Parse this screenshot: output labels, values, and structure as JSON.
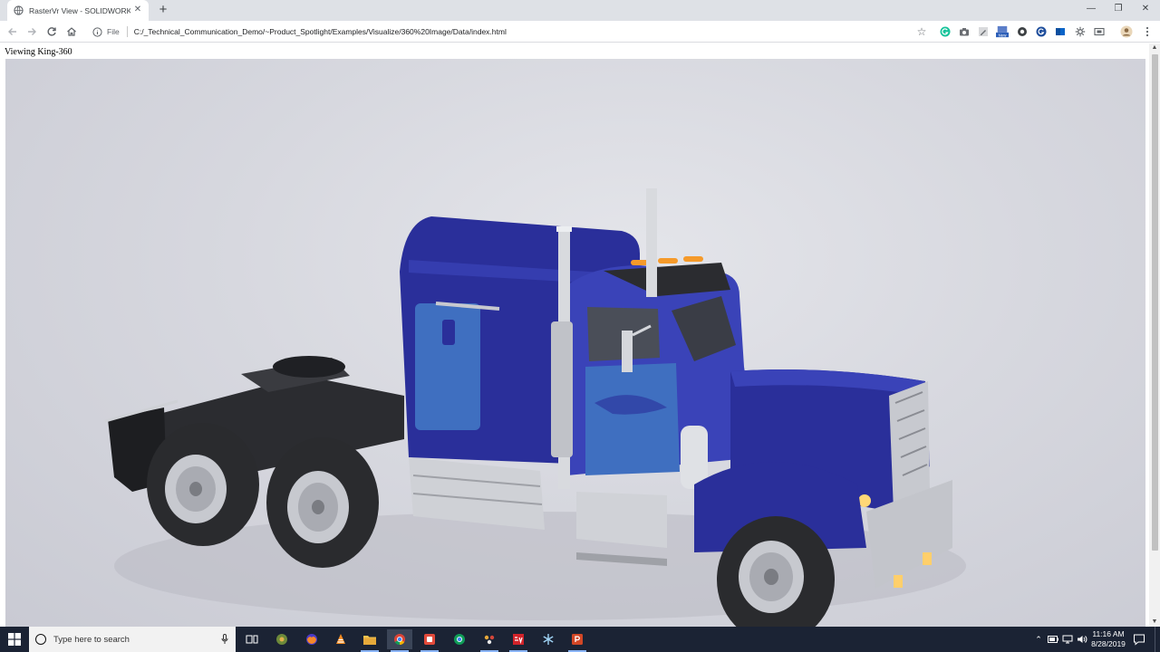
{
  "browser": {
    "tab_title": "RasterVr View - SOLIDWORKS Vis",
    "new_tab_symbol": "+",
    "close_symbol": "✕",
    "window_controls": [
      "—",
      "❐",
      "✕"
    ],
    "address_scheme": "File",
    "address_url": "C:/_Technical_Communication_Demo/~Product_Spotlight/Examples/Visualize/360%20Image/Data/index.html",
    "extensions": [
      "grammarly-icon",
      "camera-icon",
      "edit-icon",
      "new-badge-icon",
      "circle-icon",
      "g-icon",
      "outlook-icon",
      "settings-icon",
      "cast-icon",
      "profile-avatar",
      "menu-icon"
    ],
    "new_badge": "New"
  },
  "page": {
    "heading": "Viewing King-360",
    "viewer_subject": "blue-semi-truck-render"
  },
  "taskbar": {
    "search_placeholder": "Type here to search",
    "time": "11:16 AM",
    "date": "8/28/2019",
    "apps": [
      "task-view-icon",
      "app-icon-1",
      "firefox-icon",
      "vlc-icon",
      "file-explorer-icon",
      "chrome-icon",
      "snagit-icon",
      "chrome-2-icon",
      "app-icon-2",
      "solidworks-icon",
      "snowflake-icon",
      "powerpoint-icon"
    ],
    "accent": "#1b2334"
  },
  "colors": {
    "truck_body": "#2a2f9a",
    "truck_cab": "#3a43b8",
    "truck_panel": "#3f6fc0",
    "chrome": "#c7c9cf",
    "tire": "#2a2b2e",
    "studio_bg": "#d7d8df"
  }
}
